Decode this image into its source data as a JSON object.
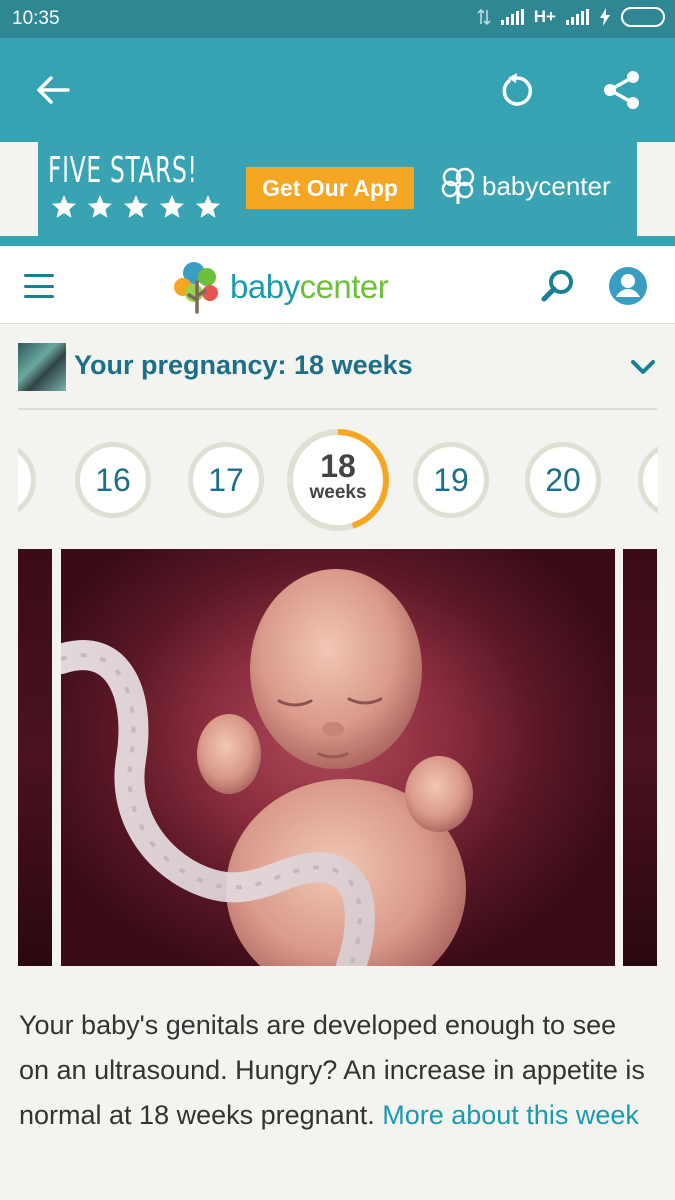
{
  "status_bar": {
    "time": "10:35",
    "network_label": "H+",
    "battery_color": "#5ee04c"
  },
  "app_bar": {
    "back_icon": "arrow-left-icon",
    "refresh_icon": "refresh-icon",
    "share_icon": "share-icon",
    "background": "#36a3b3"
  },
  "ad_banner": {
    "headline": "FIVE STARS!",
    "star_count": 5,
    "cta_label": "Get Our App",
    "brand": "babycenter",
    "cta_color": "#f5a623"
  },
  "site_header": {
    "menu_icon": "hamburger-menu-icon",
    "logo_text_a": "baby",
    "logo_text_b": "center",
    "search_icon": "search-icon",
    "account_icon": "account-icon",
    "brand_color": "#1a9ab1"
  },
  "pregnancy": {
    "title": "Your pregnancy: 18 weeks",
    "dropdown_icon": "chevron-down-icon"
  },
  "weeks": {
    "items": [
      "16",
      "17",
      "19",
      "20"
    ],
    "current": "18",
    "current_unit": "weeks",
    "progress_fraction": 0.45,
    "progress_color": "#f5a623"
  },
  "description": {
    "text": "Your baby's genitals are developed enough to see on an ultrasound. Hungry? An increase in appetite is normal at 18 weeks pregnant. ",
    "link": "More about this week"
  }
}
